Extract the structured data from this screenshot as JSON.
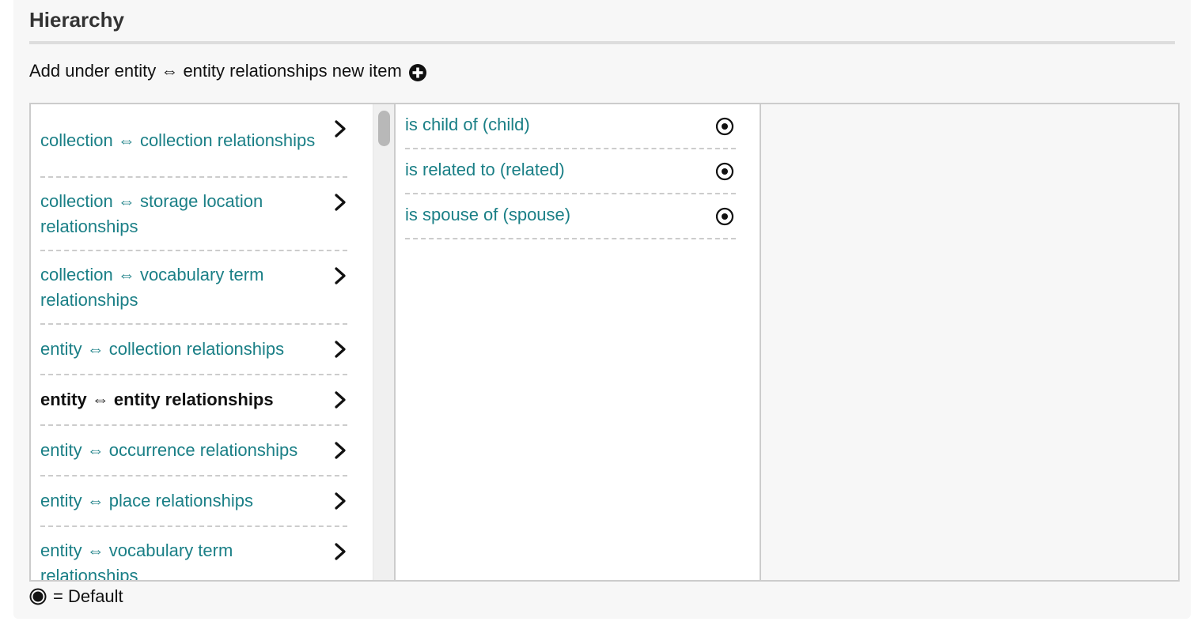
{
  "header": {
    "title": "Hierarchy"
  },
  "add_line": {
    "text": "Add under entity ⇔ entity relationships new item",
    "icon": "plus-circle-icon"
  },
  "column1": {
    "items": [
      {
        "label": "collection ⇔ collection relationships",
        "selected": false
      },
      {
        "label": "collection ⇔ storage location relationships",
        "selected": false
      },
      {
        "label": "collection ⇔ vocabulary term relationships",
        "selected": false
      },
      {
        "label": "entity ⇔ collection relationships",
        "selected": false
      },
      {
        "label": "entity ⇔ entity relationships",
        "selected": true
      },
      {
        "label": "entity ⇔ occurrence relationships",
        "selected": false
      },
      {
        "label": "entity ⇔ place relationships",
        "selected": false
      },
      {
        "label": "entity ⇔ vocabulary term relationships",
        "selected": false
      }
    ],
    "item_icon": "chevron-right-icon"
  },
  "column2": {
    "items": [
      {
        "label": "is child of (child)"
      },
      {
        "label": "is related to (related)"
      },
      {
        "label": "is spouse of (spouse)"
      }
    ],
    "item_icon": "radio-default-icon"
  },
  "legend": {
    "text": "= Default",
    "icon": "filled-circle-icon"
  },
  "colors": {
    "link": "#1a7f86",
    "selected": "#111111",
    "panel_bg": "#f7f7f7",
    "border": "#cccccc"
  }
}
